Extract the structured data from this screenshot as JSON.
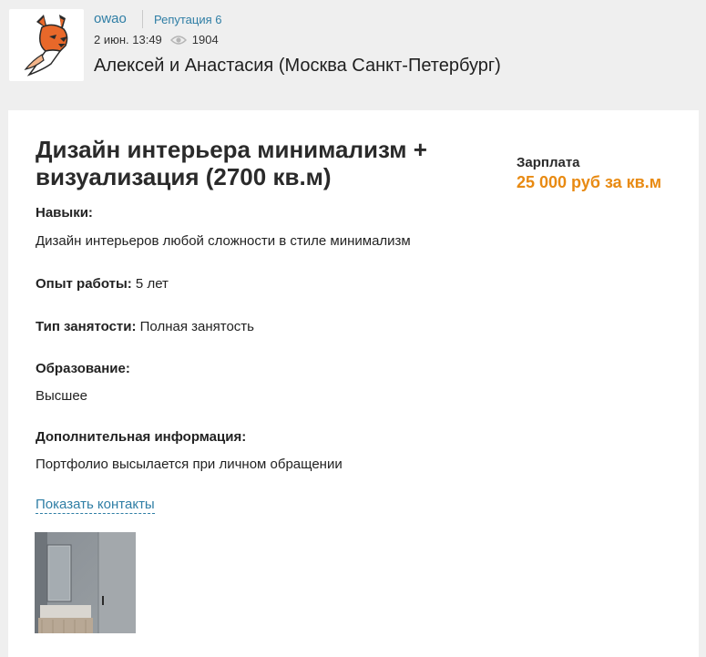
{
  "header": {
    "username": "owao",
    "reputation": "Репутация 6",
    "date": "2 июн. 13:49",
    "views": "1904",
    "author": "Алексей и Анастасия (Москва Санкт-Петербург)"
  },
  "resume": {
    "title": "Дизайн интерьера минимализм + визуализация (2700 кв.м)",
    "salary_label": "Зарплата",
    "salary_value": "25 000 руб за кв.м",
    "skills_label": "Навыки:",
    "skills_value": "Дизайн интерьеров любой сложности в стиле минимализм",
    "experience_label": "Опыт работы:",
    "experience_value": " 5 лет",
    "employment_label": "Тип занятости:",
    "employment_value": " Полная занятость",
    "education_label": "Образование:",
    "education_value": "Высшее",
    "extra_label": "Дополнительная информация:",
    "extra_value": "Портфолио высылается при личном обращении",
    "contacts_link": "Показать контакты"
  },
  "icons": {
    "avatar": "fox-logo",
    "views": "eye-icon"
  },
  "colors": {
    "link": "#2f7ea5",
    "salary": "#e88a12",
    "background": "#efefef"
  }
}
